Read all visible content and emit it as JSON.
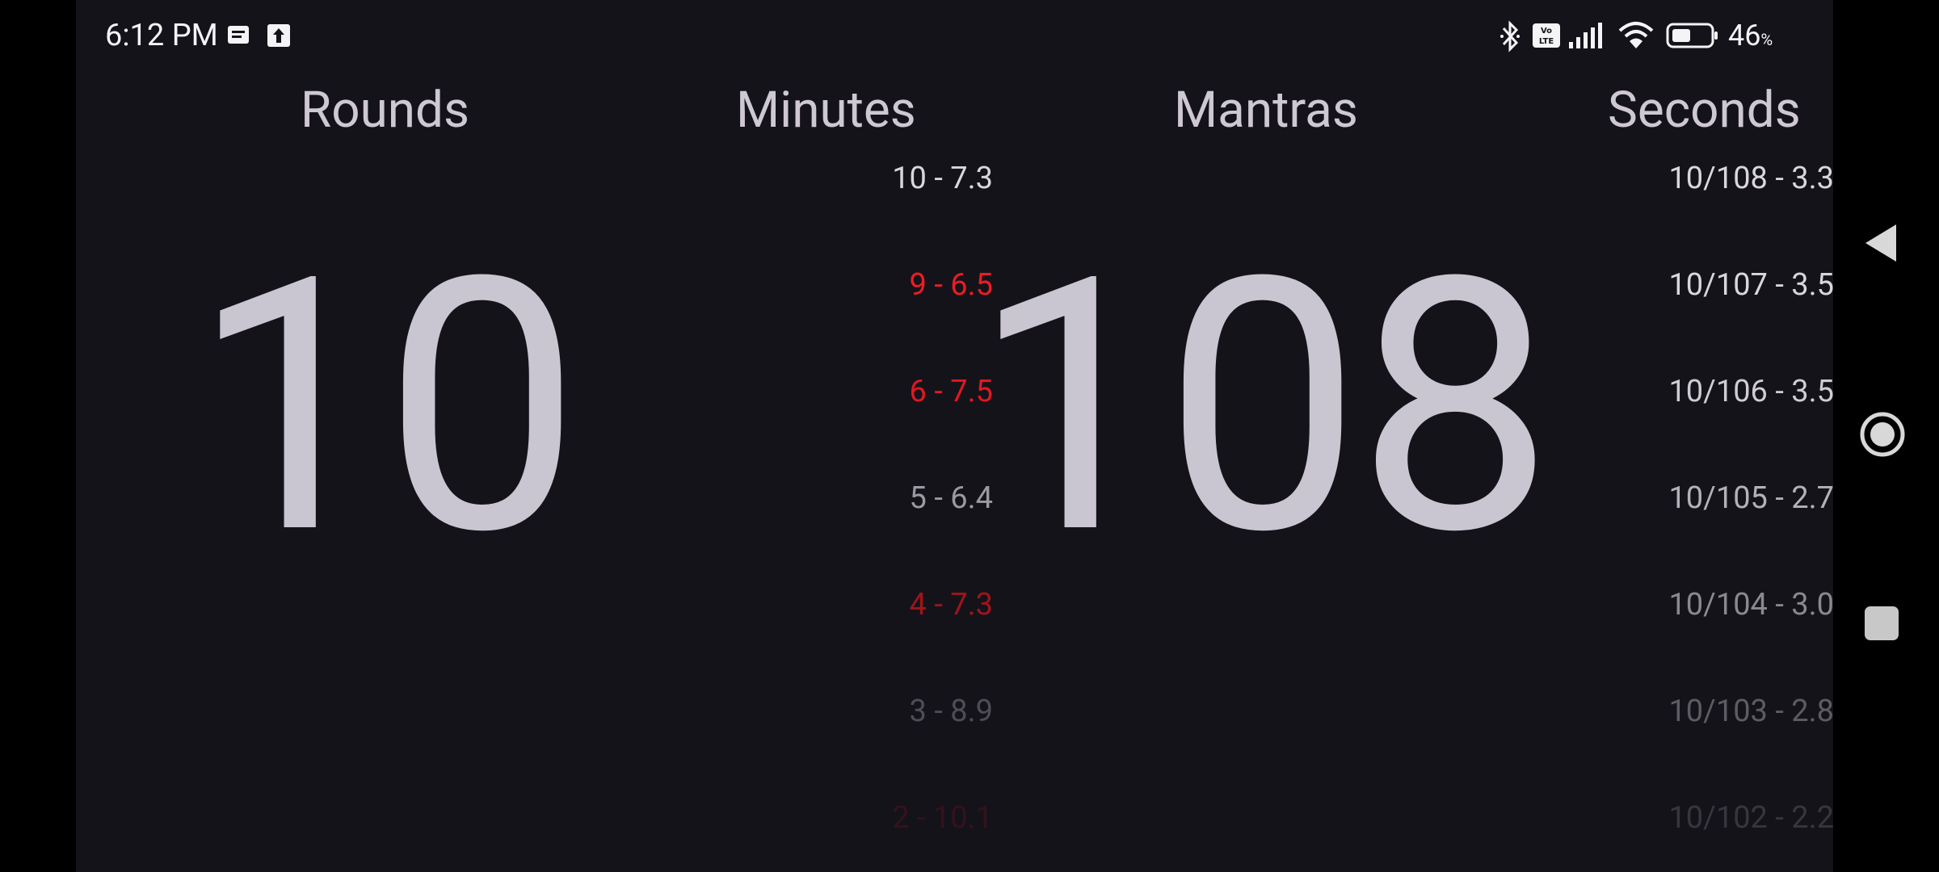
{
  "status_bar": {
    "time": "6:12 PM",
    "battery_percent": "46",
    "battery_unit": "%",
    "icons": [
      "message-icon",
      "upload-icon",
      "bluetooth-icon",
      "volte-icon",
      "signal-icon",
      "wifi-icon",
      "battery-icon"
    ]
  },
  "headers": {
    "rounds": "Rounds",
    "minutes": "Minutes",
    "mantras": "Mantras",
    "seconds": "Seconds"
  },
  "rounds_value": "10",
  "mantras_value": "108",
  "minutes_list": [
    {
      "text": "10 - 7.3",
      "color": "#d9d6dc"
    },
    {
      "text": "9 - 6.5",
      "color": "#ee1c24"
    },
    {
      "text": "6 - 7.5",
      "color": "#e3171f"
    },
    {
      "text": "5 - 6.4",
      "color": "#9c99a1"
    },
    {
      "text": "4 - 7.3",
      "color": "#a0141a"
    },
    {
      "text": "3 - 8.9",
      "color": "#4f4c55"
    },
    {
      "text": "2 - 10.1",
      "color": "#34131a"
    }
  ],
  "seconds_list": [
    {
      "text": "10/108 - 3.3",
      "color": "#d9d6dc"
    },
    {
      "text": "10/107 - 3.5",
      "color": "#d9d6dc"
    },
    {
      "text": "10/106 - 3.5",
      "color": "#cfccd3"
    },
    {
      "text": "10/105 - 2.7",
      "color": "#b4b1b8"
    },
    {
      "text": "10/104 - 3.0",
      "color": "#8b8890"
    },
    {
      "text": "10/103 - 2.8",
      "color": "#5e5b63"
    },
    {
      "text": "10/102 - 2.2",
      "color": "#38353d"
    }
  ],
  "colors": {
    "background": "#15131a",
    "accent_red": "#ee1c24",
    "text_primary": "#cac6d1"
  },
  "nav": [
    "back-icon",
    "home-icon",
    "recents-icon"
  ]
}
